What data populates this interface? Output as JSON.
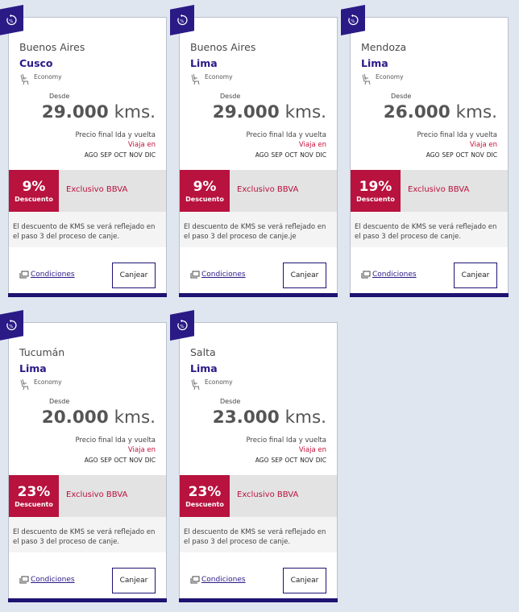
{
  "labels": {
    "desde": "Desde",
    "kms_unit": "kms.",
    "precio_final": "Precio final Ida y vuelta",
    "viaja_en": "Viaja en",
    "months": [
      "AGO",
      "SEP",
      "OCT",
      "NOV",
      "DIC"
    ],
    "descuento": "Descuento",
    "exclusivo": "Exclusivo BBVA",
    "condiciones": "Condiciones",
    "canjear": "Canjear",
    "class": "Economy"
  },
  "colors": {
    "brand_navy": "#2a1a86",
    "discount_red": "#b8123e",
    "bottom_bar": "#1e1372"
  },
  "icons": {
    "badge": "discount-badge-icon",
    "seat": "seat-icon",
    "conditions": "ticket-icon"
  },
  "offers": [
    {
      "origin": "Buenos Aires",
      "destination": "Cusco",
      "price": "29.000",
      "discount": "9%",
      "note": "El descuento de KMS se verá reflejado en el paso 3 del proceso de canje."
    },
    {
      "origin": "Buenos Aires",
      "destination": "Lima",
      "price": "29.000",
      "discount": "9%",
      "note": "El descuento de KMS se verá reflejado en el paso 3 del proceso de canje.je"
    },
    {
      "origin": "Mendoza",
      "destination": "Lima",
      "price": "26.000",
      "discount": "19%",
      "note": "El descuento de KMS se verá reflejado en el paso 3 del proceso de canje."
    },
    {
      "origin": "Tucumán",
      "destination": "Lima",
      "price": "20.000",
      "discount": "23%",
      "note": "El descuento de KMS se verá reflejado en el paso 3 del proceso de canje."
    },
    {
      "origin": "Salta",
      "destination": "Lima",
      "price": "23.000",
      "discount": "23%",
      "note": "El descuento de KMS se verá reflejado en el paso 3 del proceso de canje."
    }
  ]
}
